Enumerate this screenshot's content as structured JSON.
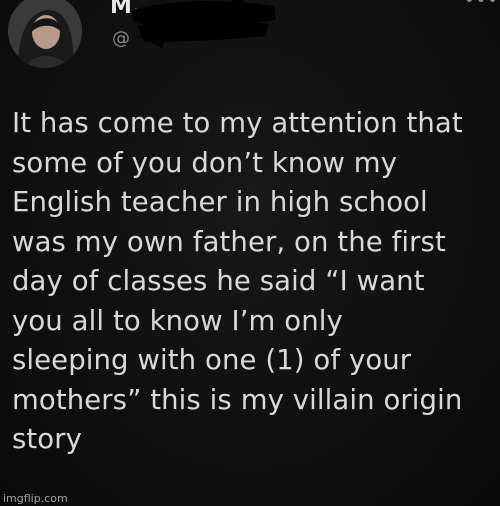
{
  "tweet": {
    "display_name": "M.",
    "handle": "@",
    "more_icon": "ellipsis-icon",
    "text": "It has come to my attention that\nsome of you don’t know my\nEnglish teacher in high school\nwas my own father, on the first\nday of classes he said “I want\nyou all to know I’m only\nsleeping with one (1) of your\nmothers” this is my villain origin\nstory"
  },
  "watermark": {
    "text": "imgflip.com"
  },
  "colors": {
    "background": "#0d0d0d",
    "text": "#d9d9d9",
    "secondary_text": "#8a8a8a",
    "redaction": "#000000"
  }
}
